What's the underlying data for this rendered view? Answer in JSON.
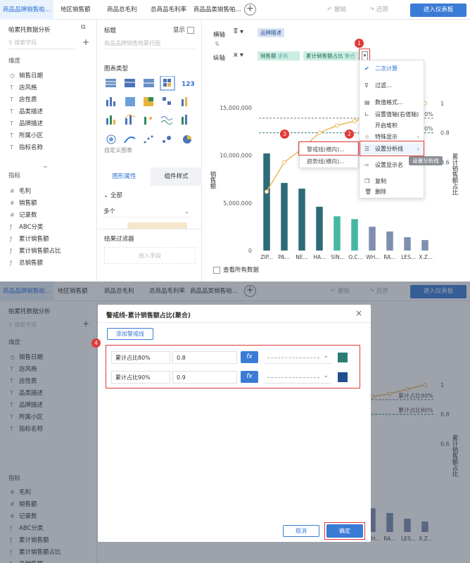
{
  "tabs": [
    "商品品牌销售帕...",
    "地区销售额",
    "商品总毛利",
    "总商品毛利率",
    "商品品类销售帕..."
  ],
  "toolbar": {
    "undo": "撤销",
    "redo": "还原",
    "enter_dashboard": "进入仪表板"
  },
  "left_panel": {
    "title": "帕累托数据分析",
    "search_placeholder": "搜索字段",
    "dimension_header": "维度",
    "dimensions": [
      "销售日期",
      "店风格",
      "店性质",
      "品类描述",
      "品牌描述",
      "所属小区",
      "指标名称"
    ],
    "measure_header": "指标",
    "measures": [
      "毛利",
      "销售额",
      "记录数",
      "ABC分类",
      "累计销售额",
      "累计销售额占比",
      "总销售额"
    ]
  },
  "mid_panel": {
    "title_label": "标题",
    "show_label": "显示",
    "title_placeholder": "商品品牌销售帕累托图",
    "chart_type_label": "图表类型",
    "custom_chart": "自定义图表",
    "tab_graphic": "图形属性",
    "tab_component": "组件样式",
    "all_label": "全部",
    "multiple_label": "多个",
    "result_filter": "结果过滤器",
    "drag_field": "拖入字段"
  },
  "axis": {
    "x_label": "横轴",
    "x_field": "品牌描述",
    "y_label": "纵轴",
    "y_field1": "销售额",
    "y_field1_agg": "求和",
    "y_field2": "累计销售额占比",
    "y_field2_agg": "聚合"
  },
  "context_menu": {
    "items": [
      "二次计算",
      "过滤...",
      "数值格式...",
      "设置值轴(右值轴)",
      "开启堆积",
      "特殊显示",
      "设置分析线",
      "设置显示名",
      "复制",
      "删除"
    ],
    "tooltip": "设置分析线"
  },
  "submenu": {
    "items": [
      "警戒线(横向)...",
      "趋势线(横向)..."
    ]
  },
  "badges": [
    "1",
    "2",
    "3",
    "4"
  ],
  "chart_data": {
    "type": "bar",
    "categories": [
      "ZIP...",
      "PA...",
      "NE...",
      "HA...",
      "SIN...",
      "O.C...",
      "WH...",
      "RA...",
      "LES...",
      "X.Z..."
    ],
    "series": [
      {
        "name": "销售额",
        "type": "bar",
        "values": [
          10200000,
          7100000,
          6500000,
          4600000,
          3600000,
          3300000,
          2500000,
          2000000,
          1400000,
          1100000
        ]
      },
      {
        "name": "累计销售额占比",
        "type": "line",
        "axis": "right",
        "values": [
          0.4,
          0.6,
          0.69,
          0.8,
          0.85,
          0.88,
          0.92,
          0.94,
          0.97,
          1.0
        ]
      }
    ],
    "xlabel": "品牌描述",
    "ylabel": "销售额",
    "y2label": "累计销售额占比",
    "yticks": [
      "0",
      "5,000,000",
      "10,000,000",
      "15,000,000"
    ],
    "ylim": [
      0,
      17000000
    ],
    "y2ticks": [
      "0.6",
      "0.8",
      "1"
    ],
    "y2lim": [
      0,
      1.1
    ],
    "warning_lines": [
      {
        "label": "累计占比80%",
        "value": 0.8
      },
      {
        "label": "累计占比90%",
        "value": 0.9
      }
    ],
    "label_80_partial": "80%",
    "label_90_partial": "90%",
    "view_all_data": "查看所有数据"
  },
  "dialog": {
    "title": "警戒线-累计销售额占比(聚合)",
    "add_button": "添加警戒线",
    "rows": [
      {
        "name": "累计占比80%",
        "value": "0.8",
        "color": "#2e7d74"
      },
      {
        "name": "累计占比90%",
        "value": "0.9",
        "color": "#1f4f8f"
      }
    ],
    "fx": "fx",
    "cancel": "取消",
    "ok": "确定"
  }
}
